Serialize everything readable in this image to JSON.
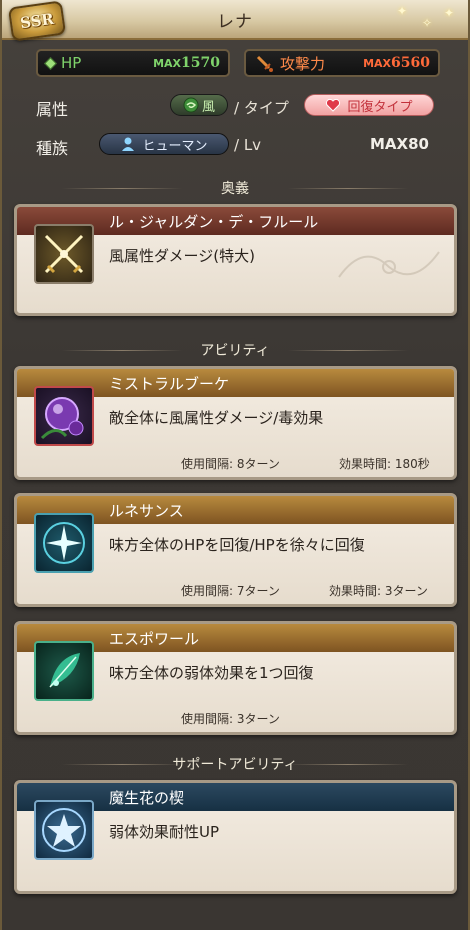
{
  "header": {
    "rarity": "SSR",
    "character_name": "レナ"
  },
  "stats": {
    "hp_label": "HP",
    "hp_max_prefix": "MAX",
    "hp_value": "1570",
    "atk_label": "攻撃力",
    "atk_max_prefix": "MAX",
    "atk_value": "6560"
  },
  "attributes": {
    "element_label": "属性",
    "element_value": "風",
    "type_sep": "/ タイプ",
    "type_value": "回復タイプ",
    "race_label": "種族",
    "race_value": "ヒューマン",
    "lv_sep": "/ Lv",
    "max_lv": "MAX80"
  },
  "sections": {
    "ougi": "奥義",
    "abilities": "アビリティ",
    "support": "サポートアビリティ"
  },
  "ougi": {
    "name": "ル・ジャルダン・デ・フルール",
    "desc": "風属性ダメージ(特大)"
  },
  "abilities": [
    {
      "name": "ミストラルブーケ",
      "desc": "敵全体に風属性ダメージ/毒効果",
      "cooldown": "使用間隔: 8ターン",
      "duration": "効果時間: 180秒"
    },
    {
      "name": "ルネサンス",
      "desc": "味方全体のHPを回復/HPを徐々に回復",
      "cooldown": "使用間隔: 7ターン",
      "duration": "効果時間: 3ターン"
    },
    {
      "name": "エスポワール",
      "desc": "味方全体の弱体効果を1つ回復",
      "cooldown": "使用間隔: 3ターン",
      "duration": ""
    }
  ],
  "support": {
    "name": "魔生花の楔",
    "desc": "弱体効果耐性UP"
  },
  "colors": {
    "hp_green": "#7fd36b",
    "atk_orange": "#ff6a3a",
    "heal_pink": "#f1a2a2",
    "card_bg": "#f0e8dc"
  }
}
